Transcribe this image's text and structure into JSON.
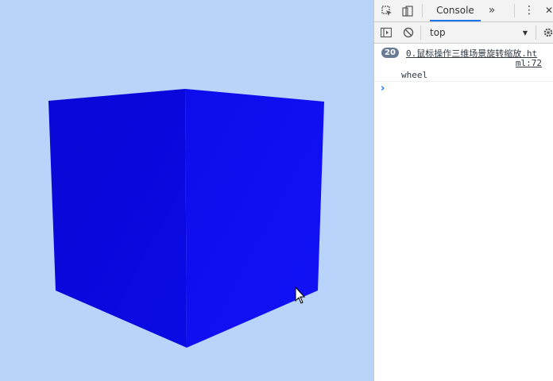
{
  "scene": {
    "background_color": "#b8d4fb",
    "cube_front_color": "#0808d8",
    "cube_side_color": "#0f10f2",
    "cursor_icon": "arrow-cursor-icon"
  },
  "devtools": {
    "tabs": {
      "inspect_icon": "element-picker-icon",
      "device_icon": "device-toolbar-icon",
      "active_tab_label": "Console",
      "more_tabs_label": "»",
      "menu_icon": "kebab-menu-icon",
      "close_label": "✕"
    },
    "toolbar": {
      "sidebar_icon": "show-sidebar-icon",
      "clear_icon": "clear-console-icon",
      "context_value": "top",
      "context_arrow": "▼",
      "settings_icon": "gear-icon"
    },
    "console": {
      "entries": [
        {
          "count": "20",
          "source": "0.鼠标操作三维场景旋转缩放.ht",
          "line": "ml:72",
          "message": "wheel"
        }
      ],
      "prompt_symbol": "›"
    }
  }
}
